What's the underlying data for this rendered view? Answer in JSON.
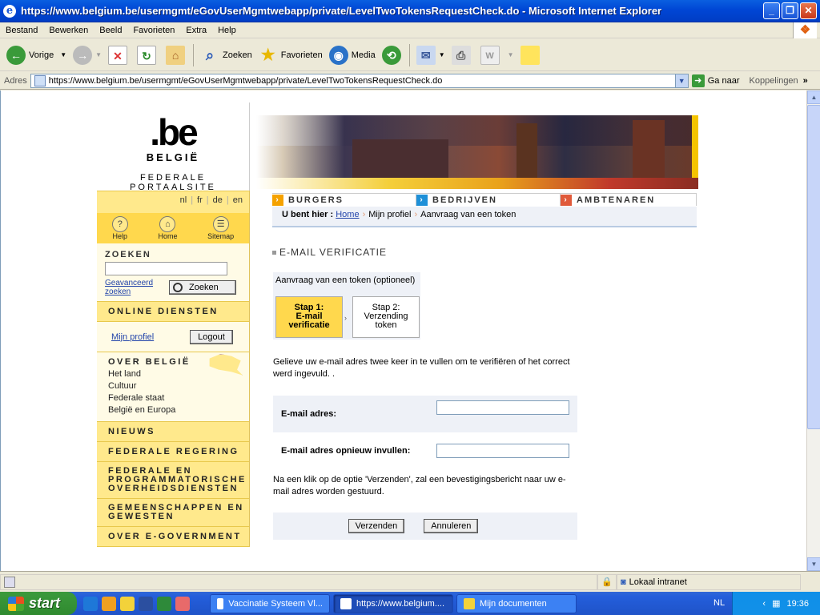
{
  "window": {
    "title": "https://www.belgium.be/usermgmt/eGovUserMgmtwebapp/private/LevelTwoTokensRequestCheck.do - Microsoft Internet Explorer"
  },
  "menu": [
    "Bestand",
    "Bewerken",
    "Beeld",
    "Favorieten",
    "Extra",
    "Help"
  ],
  "toolbar": {
    "back": "Vorige",
    "search": "Zoeken",
    "favorites": "Favorieten",
    "media": "Media"
  },
  "address": {
    "label": "Adres",
    "url": "https://www.belgium.be/usermgmt/eGovUserMgmtwebapp/private/LevelTwoTokensRequestCheck.do",
    "go": "Ga naar",
    "links": "Koppelingen"
  },
  "site": {
    "logo_text": ".be",
    "country": "BELGIË",
    "portal": "FEDERALE PORTAALSITE",
    "langs": [
      "nl",
      "fr",
      "de",
      "en"
    ],
    "icons": [
      {
        "label": "Help",
        "icon": "help-icon"
      },
      {
        "label": "Home",
        "icon": "home-icon"
      },
      {
        "label": "Sitemap",
        "icon": "sitemap-icon"
      }
    ],
    "search_heading": "ZOEKEN",
    "advanced_line1": "Geavanceerd",
    "advanced_line2": "zoeken",
    "search_button": "Zoeken",
    "online": "ONLINE DIENSTEN",
    "my_profile": "Mijn profiel",
    "logout": "Logout",
    "over_heading": "OVER BELGIË",
    "over_items": [
      "Het land",
      "Cultuur",
      "Federale staat",
      "België en Europa"
    ],
    "news": "NIEUWS",
    "gov": "FEDERALE REGERING",
    "fed_services_1": "FEDERALE EN",
    "fed_services_2": "PROGRAMMATORISCHE",
    "fed_services_3": "OVERHEIDSDIENSTEN",
    "communities_1": "GEMEENSCHAPPEN EN",
    "communities_2": "GEWESTEN",
    "egov": "OVER E-GOVERNMENT",
    "tabs": [
      "BURGERS",
      "BEDRIJVEN",
      "AMBTENAREN"
    ],
    "tab_colors": [
      "#f5a200",
      "#1e90d8",
      "#e05a3a"
    ]
  },
  "breadcrumb": {
    "prefix": "U bent hier :",
    "home": "Home",
    "profile": "Mijn profiel",
    "current": "Aanvraag van een token"
  },
  "page": {
    "title": "E-MAIL VERIFICATIE",
    "steps_caption": "Aanvraag van een token (optioneel)",
    "step1": [
      "Stap 1:",
      "E-mail",
      "verificatie"
    ],
    "step2": [
      "Stap 2:",
      "Verzending",
      "token"
    ],
    "instruction": "Gelieve uw e-mail adres twee keer in te vullen om te verifiëren of het correct werd ingevuld. .",
    "email_label": "E-mail adres:",
    "email_repeat_label": "E-mail adres opnieuw invullen:",
    "note": "Na een klik op de optie 'Verzenden', zal een bevestigingsbericht naar uw e-mail adres worden gestuurd.",
    "submit": "Verzenden",
    "cancel": "Annuleren"
  },
  "status": {
    "zone": "Lokaal intranet"
  },
  "taskbar": {
    "start": "start",
    "tasks": [
      "Vaccinatie Systeem Vl...",
      "https://www.belgium....",
      "Mijn documenten"
    ],
    "lang": "NL",
    "time": "19:36"
  }
}
